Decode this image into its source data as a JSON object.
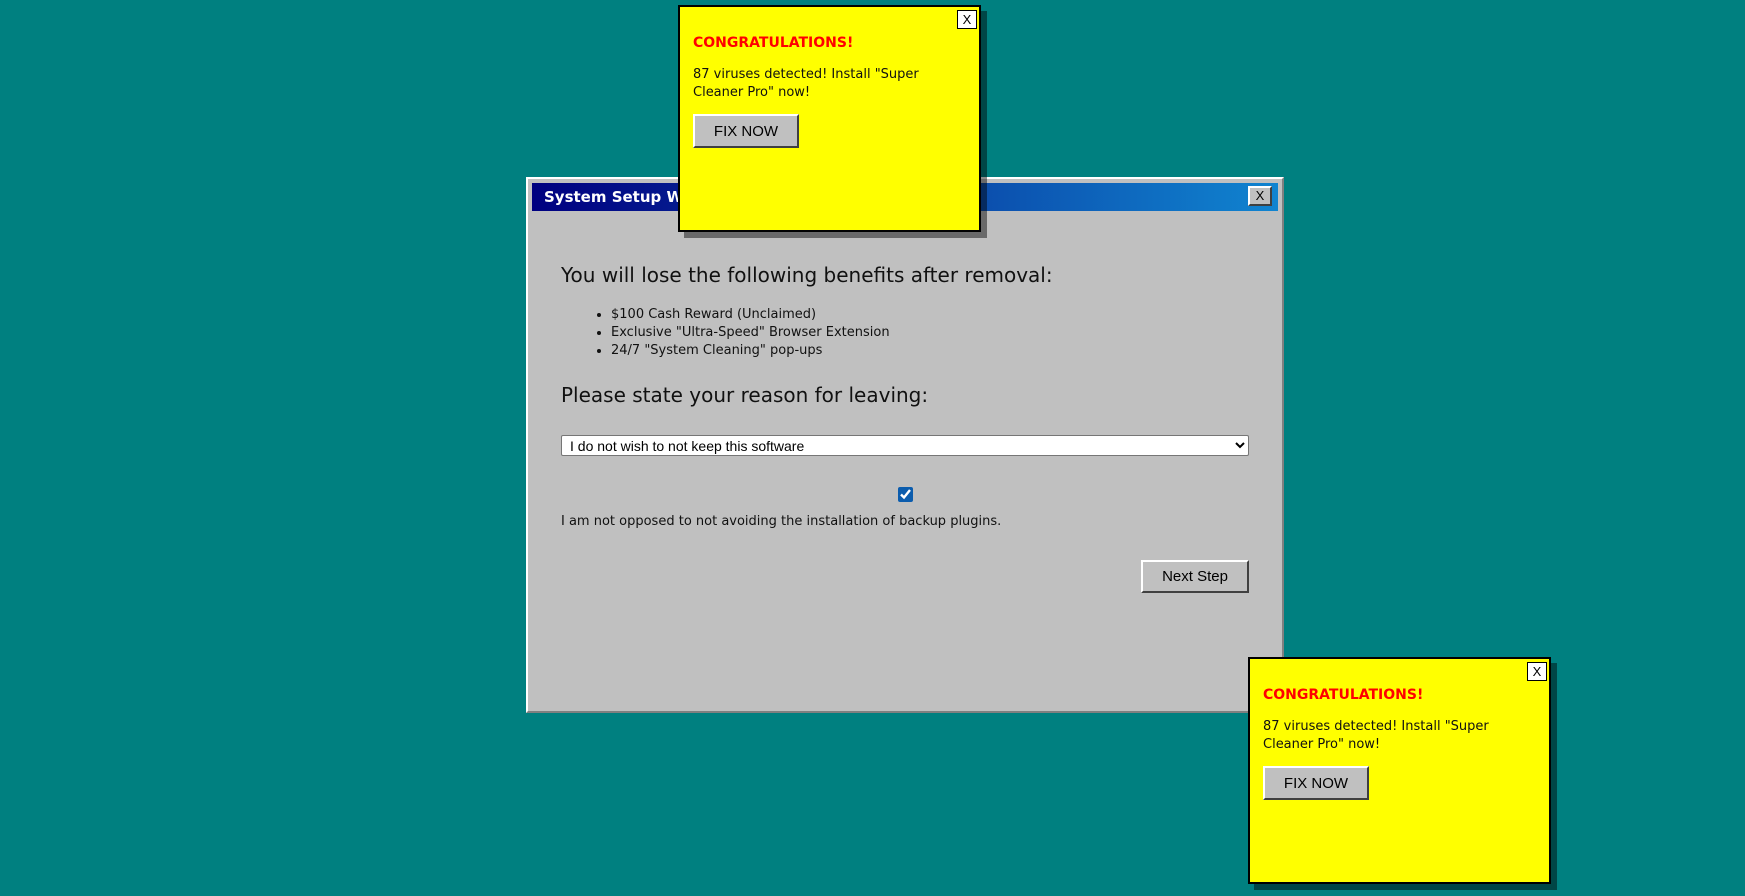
{
  "wizard": {
    "title": "System Setup Wizard",
    "close_label": "X",
    "heading": "You will lose the following benefits after removal:",
    "benefits": [
      "$100 Cash Reward (Unclaimed)",
      "Exclusive \"Ultra-Speed\" Browser Extension",
      "24/7 \"System Cleaning\" pop-ups"
    ],
    "reason_heading": "Please state your reason for leaving:",
    "reason_select": {
      "selected": "I do not wish to not keep this software"
    },
    "checkbox": {
      "checked": true,
      "label": "I am not opposed to not avoiding the installation of backup plugins."
    },
    "next_button": "Next Step"
  },
  "popups": [
    {
      "close_label": "X",
      "title": "CONGRATULATIONS!",
      "text": "87 viruses detected! Install \"Super Cleaner Pro\" now!",
      "button": "FIX NOW"
    },
    {
      "close_label": "X",
      "title": "CONGRATULATIONS!",
      "text": "87 viruses detected! Install \"Super Cleaner Pro\" now!",
      "button": "FIX NOW"
    }
  ],
  "colors": {
    "desktop": "#008080",
    "window": "#c0c0c0",
    "titlebar_start": "#000080",
    "titlebar_end": "#1084d0",
    "popup_bg": "#ffff00",
    "popup_title": "#ff0000"
  }
}
